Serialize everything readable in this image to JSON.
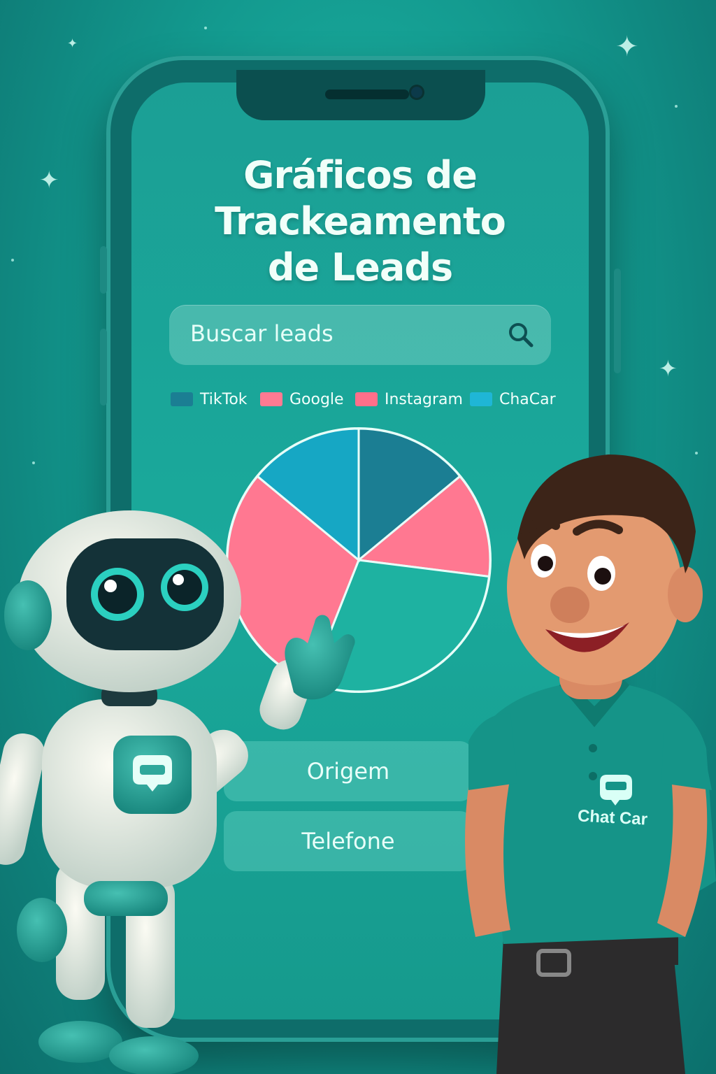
{
  "title": {
    "line1": "Gráficos de",
    "line2": "Trackeamento",
    "line3": "de Leads"
  },
  "search": {
    "placeholder": "Buscar leads",
    "icon": "search-icon"
  },
  "legend": [
    {
      "label": "TikTok",
      "color": "#1b7e93"
    },
    {
      "label": "Google",
      "color": "#ff7a92"
    },
    {
      "label": "Instagram",
      "color": "#ff6f8a"
    },
    {
      "label": "ChaCar",
      "color": "#1fb6d6"
    }
  ],
  "chart_data": {
    "type": "pie",
    "slices": [
      {
        "color": "#1b7e93",
        "value": 14
      },
      {
        "color": "#ff7891",
        "value": 13
      },
      {
        "color": "#1eb2a1",
        "value": 29
      },
      {
        "color": "#ff7891",
        "value": 30
      },
      {
        "color": "#16a7c4",
        "value": 14
      }
    ]
  },
  "fields": {
    "origem": "Origem",
    "telefone": "Telefone"
  },
  "shirt_logo": {
    "text": "Chat Car"
  },
  "colors": {
    "background": "#139a8f",
    "accent": "#1eb2a1",
    "pink": "#ff7891"
  }
}
